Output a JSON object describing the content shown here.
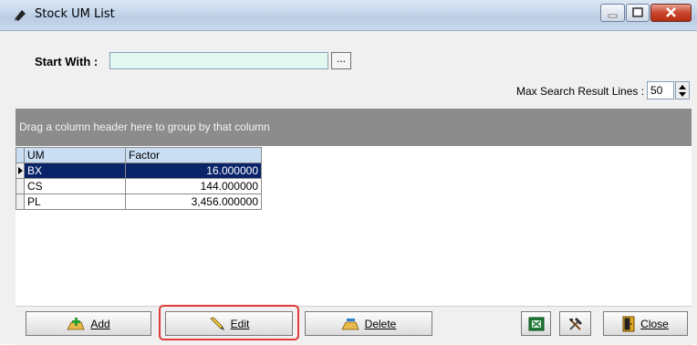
{
  "window": {
    "title": "Stock UM List"
  },
  "filter": {
    "start_label": "Start With :",
    "start_value": "",
    "ellipsis": "...",
    "max_label": "Max Search Result Lines :",
    "max_value": "50"
  },
  "grid": {
    "group_hint": "Drag a column header here to group by that column",
    "columns": [
      "UM",
      "Factor"
    ],
    "rows": [
      {
        "um": "BX",
        "factor": "16.000000",
        "selected": true
      },
      {
        "um": "CS",
        "factor": "144.000000",
        "selected": false
      },
      {
        "um": "PL",
        "factor": "3,456.000000",
        "selected": false
      }
    ]
  },
  "buttons": {
    "add_label": "Add",
    "edit_label": "Edit",
    "delete_label": "Delete",
    "close_label": "Close"
  },
  "colors": {
    "selected_row": "#0a246a",
    "highlight": "#e03a3a",
    "group_bar": "#8c8c8c"
  },
  "icons": [
    "window-icon",
    "minimize-icon",
    "maximize-icon",
    "close-icon",
    "add-icon",
    "edit-pencil-icon",
    "delete-icon",
    "excel-icon",
    "tools-icon",
    "door-icon"
  ]
}
